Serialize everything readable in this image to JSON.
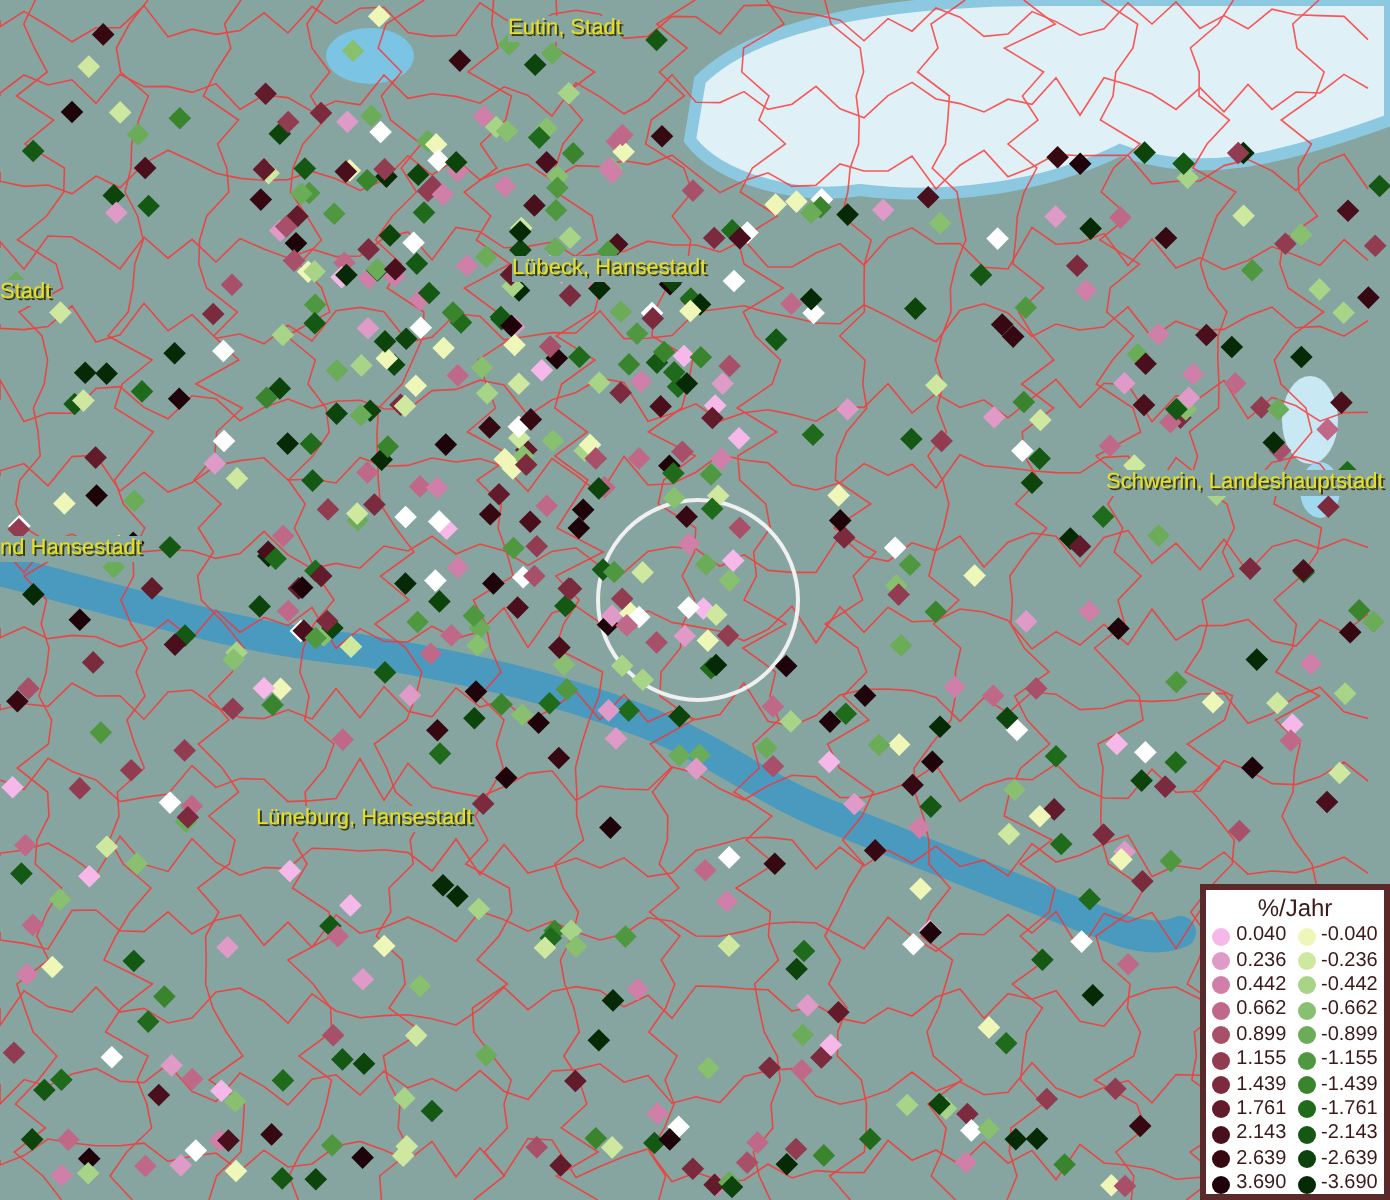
{
  "map_labels": [
    {
      "text": "Eutin, Stadt"
    },
    {
      "text": "Lübeck, Hansestadt"
    },
    {
      "text": "Stadt"
    },
    {
      "text": "Schwerin, Landeshauptstadt"
    },
    {
      "text": "nd Hansestadt"
    },
    {
      "text": "Lüneburg, Hansestadt"
    }
  ],
  "legend": {
    "title": "%/Jahr",
    "positive": [
      {
        "value": "0.040",
        "color": "#f6b8e8"
      },
      {
        "value": "0.236",
        "color": "#e09ac8"
      },
      {
        "value": "0.442",
        "color": "#d07fa8"
      },
      {
        "value": "0.662",
        "color": "#c06888"
      },
      {
        "value": "0.899",
        "color": "#a84f6a"
      },
      {
        "value": "1.155",
        "color": "#923c52"
      },
      {
        "value": "1.439",
        "color": "#7c2a3e"
      },
      {
        "value": "1.761",
        "color": "#621b2a"
      },
      {
        "value": "2.143",
        "color": "#4a0f1c"
      },
      {
        "value": "2.639",
        "color": "#360812"
      },
      {
        "value": "3.690",
        "color": "#1e040a"
      }
    ],
    "negative": [
      {
        "value": "-0.040",
        "color": "#eef6b8"
      },
      {
        "value": "-0.236",
        "color": "#cfe8a0"
      },
      {
        "value": "-0.442",
        "color": "#a8d488"
      },
      {
        "value": "-0.662",
        "color": "#88c070"
      },
      {
        "value": "-0.899",
        "color": "#6aac58"
      },
      {
        "value": "-1.155",
        "color": "#4f9840"
      },
      {
        "value": "-1.439",
        "color": "#3a842e"
      },
      {
        "value": "-1.761",
        "color": "#206a1c"
      },
      {
        "value": "-2.143",
        "color": "#145814"
      },
      {
        "value": "-2.639",
        "color": "#0c440c"
      },
      {
        "value": "-3.690",
        "color": "#062a06"
      }
    ]
  }
}
